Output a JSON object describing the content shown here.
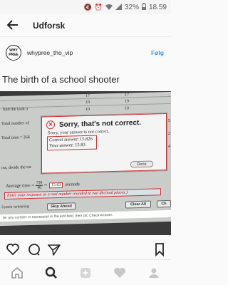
{
  "status_bar": {
    "battery": "32%",
    "time": "18.59"
  },
  "app_bar": {
    "title": "Udforsk"
  },
  "post": {
    "avatar_lines": [
      "WHY",
      "PREE"
    ],
    "username": "whypree_tho_vip",
    "follow_label": "Følg",
    "caption_title": "The birth of a school shooter"
  },
  "photo": {
    "grid_numbers": [
      "17",
      "19",
      "10"
    ],
    "bg_left": [
      "find the total n",
      "Total number of",
      "Total time = 266",
      "ow, divide the tot"
    ],
    "bg_right_column": [
      "5",
      "2",
      "4"
    ],
    "dialog": {
      "title": "Sorry, that's not correct.",
      "message": "Sorry, your answer is not correct.",
      "correct_answer": "Correct answer: 15.826",
      "your_answer": "Your answer: 15.83",
      "done_label": "Done"
    },
    "average": {
      "label": "Average time =",
      "frac_top": "728",
      "frac_bottom": "46",
      "approx": "≈",
      "answer": "15.83",
      "unit": "seconds"
    },
    "hint": "Enter your response as a real number rounded to two decimal places.)",
    "tools": {
      "parts_left": "3 parts remaining",
      "skip_label": "Skip Ahead",
      "clear_label": "Clear All",
      "check_label": "Ch"
    },
    "bottom_strip": "ter any number or expression in the edit field, then clic Check Answer."
  }
}
